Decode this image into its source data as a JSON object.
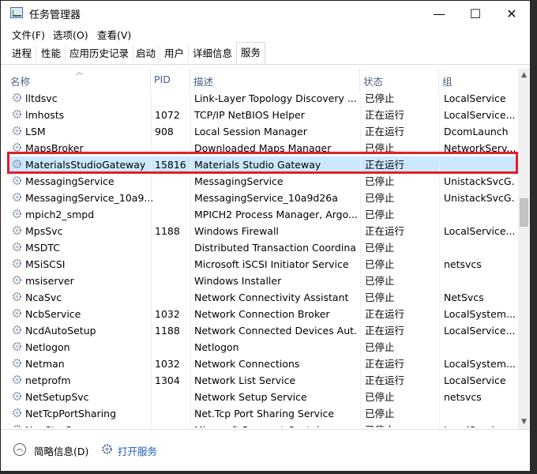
{
  "window": {
    "title": "任务管理器",
    "minimize": "—",
    "maximize": "☐",
    "close": "✕"
  },
  "menu": [
    "文件(F)",
    "选项(O)",
    "查看(V)"
  ],
  "tabs": [
    "进程",
    "性能",
    "应用历史记录",
    "启动",
    "用户",
    "详细信息",
    "服务"
  ],
  "active_tab": "服务",
  "columns": {
    "name": "名称",
    "pid": "PID",
    "desc": "描述",
    "status": "状态",
    "group": "组"
  },
  "rows": [
    {
      "name": "lltdsvc",
      "pid": "",
      "desc": "Link-Layer Topology Discovery ...",
      "status": "已停止",
      "group": "LocalService"
    },
    {
      "name": "lmhosts",
      "pid": "1072",
      "desc": "TCP/IP NetBIOS Helper",
      "status": "正在运行",
      "group": "LocalService..."
    },
    {
      "name": "LSM",
      "pid": "908",
      "desc": "Local Session Manager",
      "status": "正在运行",
      "group": "DcomLaunch"
    },
    {
      "name": "MapsBroker",
      "pid": "",
      "desc": "Downloaded Maps Manager",
      "status": "已停止",
      "group": "NetworkServ..."
    },
    {
      "name": "MaterialsStudioGateway",
      "pid": "15816",
      "desc": "Materials Studio Gateway",
      "status": "正在运行",
      "group": ""
    },
    {
      "name": "MessagingService",
      "pid": "",
      "desc": "MessagingService",
      "status": "已停止",
      "group": "UnistackSvcG..."
    },
    {
      "name": "MessagingService_10a9...",
      "pid": "",
      "desc": "MessagingService_10a9d26a",
      "status": "已停止",
      "group": "UnistackSvcG..."
    },
    {
      "name": "mpich2_smpd",
      "pid": "",
      "desc": "MPICH2 Process Manager, Argo...",
      "status": "已停止",
      "group": ""
    },
    {
      "name": "MpsSvc",
      "pid": "1188",
      "desc": "Windows Firewall",
      "status": "正在运行",
      "group": "LocalService..."
    },
    {
      "name": "MSDTC",
      "pid": "",
      "desc": "Distributed Transaction Coordina...",
      "status": "已停止",
      "group": ""
    },
    {
      "name": "MSiSCSI",
      "pid": "",
      "desc": "Microsoft iSCSI Initiator Service",
      "status": "已停止",
      "group": "netsvcs"
    },
    {
      "name": "msiserver",
      "pid": "",
      "desc": "Windows Installer",
      "status": "已停止",
      "group": ""
    },
    {
      "name": "NcaSvc",
      "pid": "",
      "desc": "Network Connectivity Assistant",
      "status": "已停止",
      "group": "NetSvcs"
    },
    {
      "name": "NcbService",
      "pid": "1032",
      "desc": "Network Connection Broker",
      "status": "正在运行",
      "group": "LocalSystem..."
    },
    {
      "name": "NcdAutoSetup",
      "pid": "1188",
      "desc": "Network Connected Devices Aut...",
      "status": "正在运行",
      "group": "LocalService..."
    },
    {
      "name": "Netlogon",
      "pid": "",
      "desc": "Netlogon",
      "status": "已停止",
      "group": ""
    },
    {
      "name": "Netman",
      "pid": "1032",
      "desc": "Network Connections",
      "status": "正在运行",
      "group": "LocalSystem..."
    },
    {
      "name": "netprofm",
      "pid": "1304",
      "desc": "Network List Service",
      "status": "正在运行",
      "group": "LocalService"
    },
    {
      "name": "NetSetupSvc",
      "pid": "",
      "desc": "Network Setup Service",
      "status": "已停止",
      "group": "netsvcs"
    },
    {
      "name": "NetTcpPortSharing",
      "pid": "",
      "desc": "Net.Tcp Port Sharing Service",
      "status": "已停止",
      "group": ""
    },
    {
      "name": "NgcCtnrSvc",
      "pid": "",
      "desc": "Microsoft Passport Container",
      "status": "已停止",
      "group": "LocalService..."
    }
  ],
  "selected_row": 4,
  "footer": {
    "brief": "简略信息(D)",
    "open_services": "打开服务"
  },
  "colors": {
    "selected": "#cce8ff",
    "highlight_box": "#e0202a",
    "header_text": "#4d6082",
    "link": "#1a5fb4"
  }
}
